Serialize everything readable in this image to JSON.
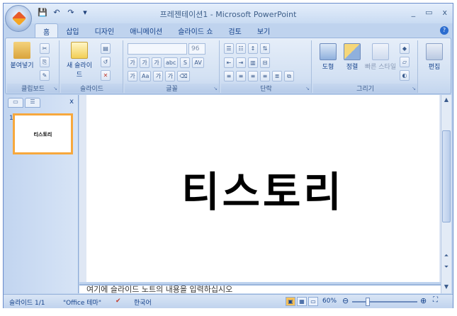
{
  "window": {
    "title": "프레젠테이션1 - Microsoft PowerPoint",
    "controls": [
      "_",
      "▭",
      "x"
    ]
  },
  "qat": {
    "save_icon": "💾",
    "undo_icon": "↶",
    "redo_icon": "↷",
    "more_icon": "▾"
  },
  "tabs": [
    {
      "label": "홈"
    },
    {
      "label": "삽입"
    },
    {
      "label": "디자인"
    },
    {
      "label": "애니메이션"
    },
    {
      "label": "슬라이드 쇼"
    },
    {
      "label": "검토"
    },
    {
      "label": "보기"
    }
  ],
  "ribbon": {
    "clipboard": {
      "paste_label": "붙여넣기",
      "group_label": "클립보드"
    },
    "slides": {
      "new_slide_label": "새 슬라이드",
      "group_label": "슬라이드"
    },
    "font": {
      "font_size": "96",
      "group_label": "글꼴"
    },
    "paragraph": {
      "group_label": "단락"
    },
    "drawing": {
      "shape_label": "도형",
      "arrange_label": "정렬",
      "quick_style_label": "빠른 스타일",
      "group_label": "그리기"
    },
    "editing": {
      "label": "편집"
    }
  },
  "panel": {
    "slide_number": "1",
    "thumb_text": "티스토리",
    "close_label": "x"
  },
  "slide": {
    "title": "티스토리"
  },
  "notes": {
    "placeholder": "여기에 슬라이드 노트의 내용을 입력하십시오"
  },
  "statusbar": {
    "slide_info": "슬라이드 1/1",
    "theme": "\"Office 테마\"",
    "language": "한국어",
    "zoom": "60%"
  }
}
